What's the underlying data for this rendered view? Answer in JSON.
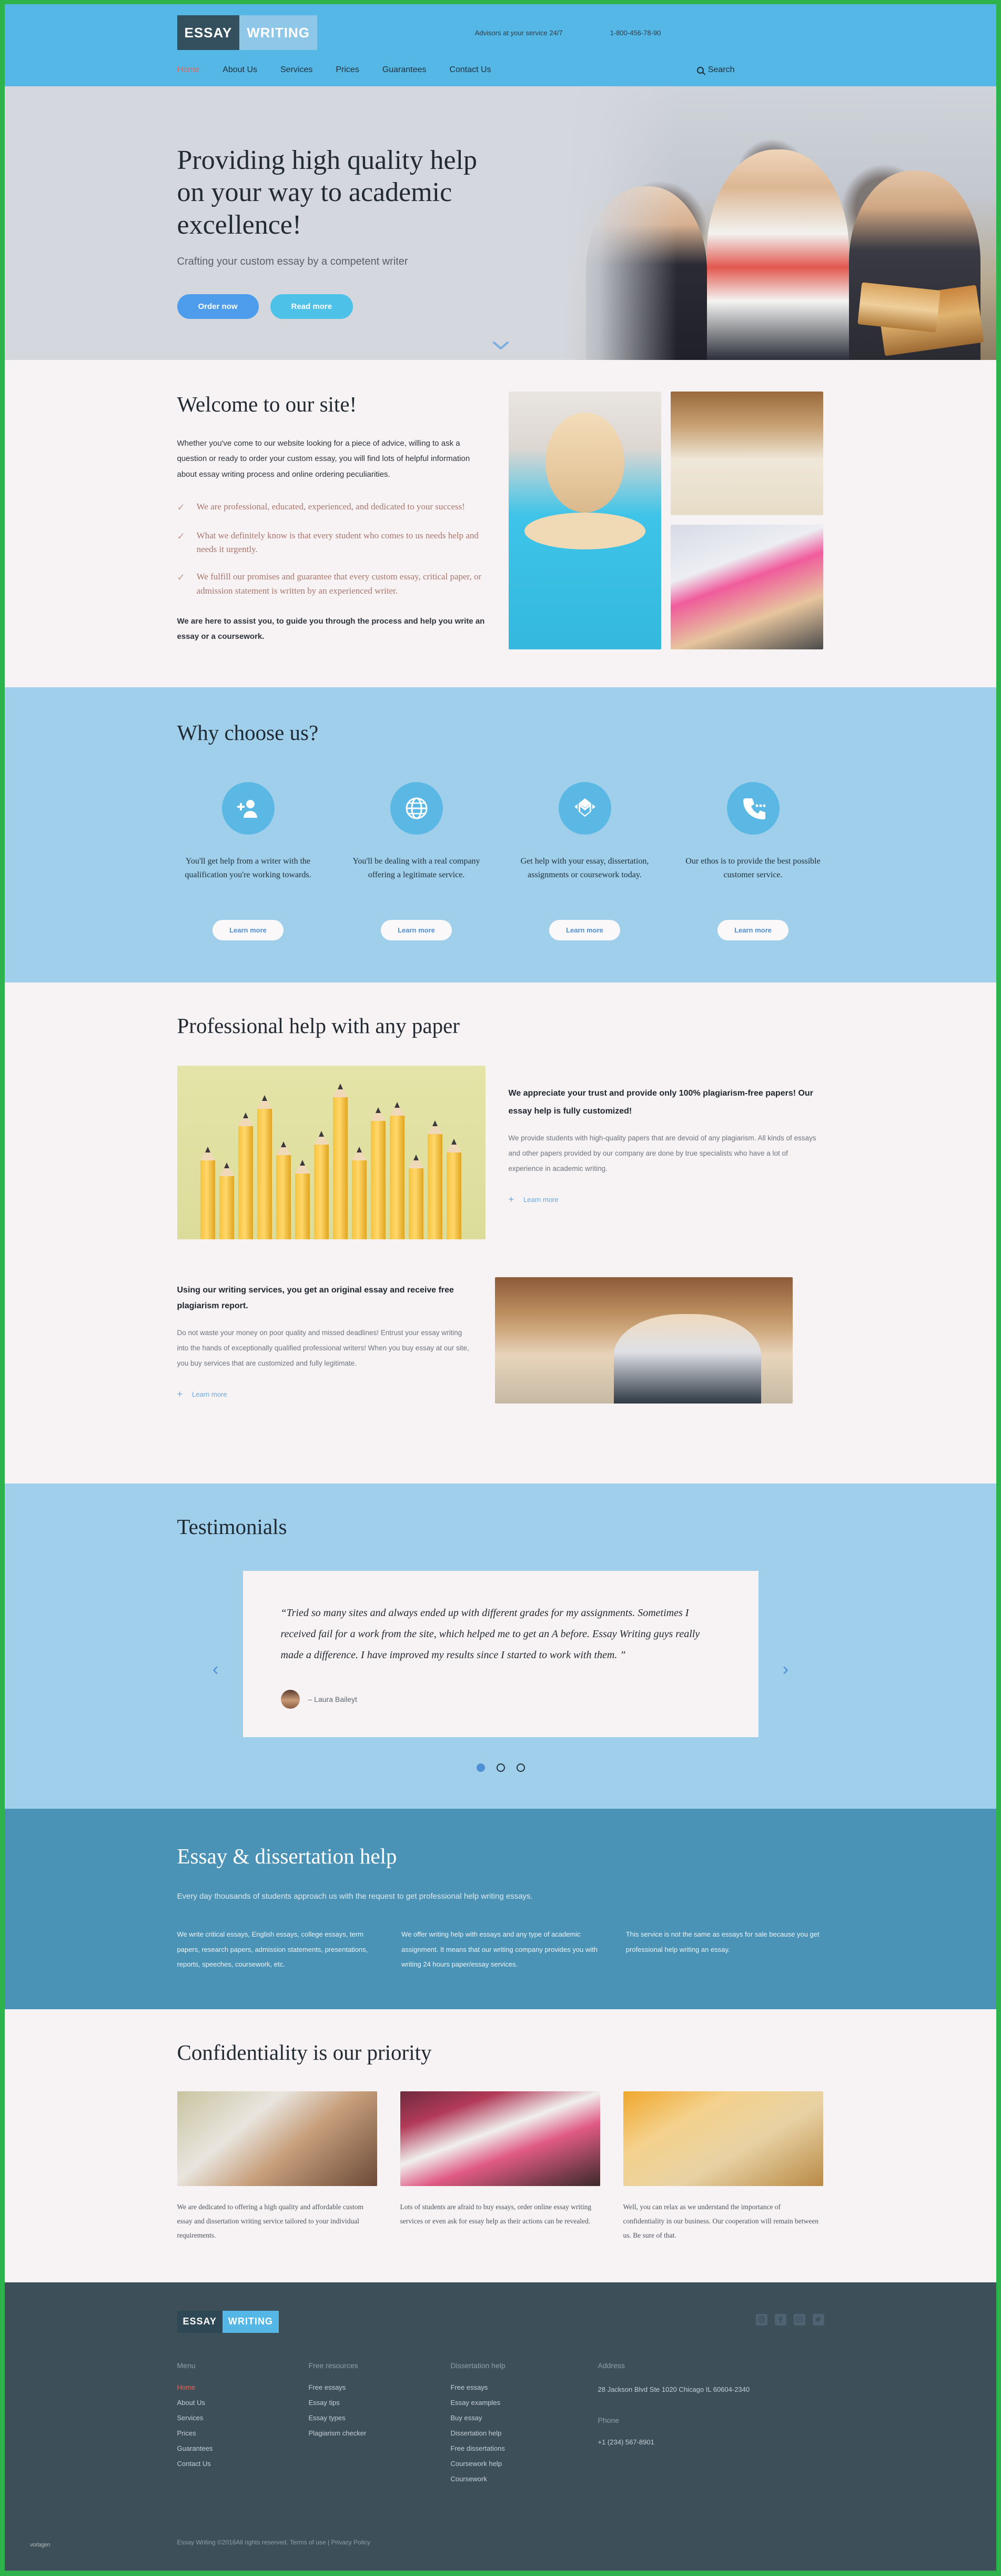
{
  "header": {
    "logo": {
      "part1": "ESSAY",
      "part2": "WRITING"
    },
    "advisors": "Advisors at your service 24/7",
    "phone": "1-800-456-78-90",
    "nav": [
      {
        "label": "Home",
        "active": true
      },
      {
        "label": "About Us",
        "active": false
      },
      {
        "label": "Services",
        "active": false
      },
      {
        "label": "Prices",
        "active": false
      },
      {
        "label": "Guarantees",
        "active": false
      },
      {
        "label": "Contact Us",
        "active": false
      }
    ],
    "search_label": "Search"
  },
  "hero": {
    "title": "Providing high quality help on your way to academic excellence!",
    "subtitle": "Crafting your custom essay by a competent writer",
    "btn_order": "Order now",
    "btn_read": "Read more"
  },
  "welcome": {
    "heading": "Welcome to our site!",
    "lead": "Whether you've come to our website looking for a piece of advice, willing to ask a question or ready to order your custom essay, you will find lots of helpful information about essay writing process and online ordering peculiarities.",
    "bullets": [
      "We are professional, educated, experienced, and dedicated to your success!",
      "What we definitely know is that every student who comes to us needs help and needs it urgently.",
      "We fulfill our promises and guarantee that every custom essay, critical paper, or admission statement is written by an experienced writer."
    ],
    "tail": "We are here to assist you, to guide you through the process and help you write an essay or a coursework."
  },
  "why": {
    "heading": "Why choose us?",
    "items": [
      {
        "icon": "add-user-icon",
        "text": "You'll get help from a writer with the qualification you're working towards.",
        "button": "Learn more"
      },
      {
        "icon": "globe-icon",
        "text": "You'll be dealing with a real company offering a legitimate service.",
        "button": "Learn more"
      },
      {
        "icon": "graduation-cap-icon",
        "text": "Get help with your essay, dissertation, assignments or coursework today.",
        "button": "Learn more"
      },
      {
        "icon": "phone-icon",
        "text": "Our ethos is to provide the best possible customer service.",
        "button": "Learn more"
      }
    ]
  },
  "professional": {
    "heading": "Professional help with any paper",
    "block1": {
      "title": "We appreciate your trust and provide only 100% plagiarism-free papers! Our essay help is fully customized!",
      "body": "We provide students with high-quality papers that are devoid of any plagiarism. All kinds of essays and other papers provided by our company are done by true specialists who have a lot of experience in academic writing.",
      "link": "Learn more"
    },
    "block2": {
      "title": "Using our writing services, you get an original essay and receive free plagiarism report.",
      "body": "Do not waste your money on poor quality and missed deadlines! Entrust your essay writing into the hands of exceptionally qualified professional writers! When you buy essay at our site, you buy services that are customized and fully legitimate.",
      "link": "Learn more"
    }
  },
  "testimonials": {
    "heading": "Testimonials",
    "quote": "“Tried so many sites and always ended up with different grades for my assignments. Sometimes I received fail for a work from the site, which helped me to get an A before. Essay Writing guys really made a difference. I have improved my results since I started to work with them. ”",
    "author": "– Laura Baileyt",
    "prev": "‹",
    "next": "›",
    "dots": 3,
    "active_dot": 0
  },
  "dissertation": {
    "heading": "Essay & dissertation help",
    "subtitle": "Every day thousands of students approach us with the request to get professional help writing essays.",
    "columns": [
      "We write critical essays, English essays, college essays, term papers, research papers, admission statements, presentations, reports, speeches, coursework, etc.",
      "We offer writing help with essays and any type of academic assignment. It means that our writing company provides you with writing 24 hours paper/essay services.",
      "This service is not the same as essays for sale because you get professional help writing an essay."
    ]
  },
  "confidentiality": {
    "heading": "Confidentiality is our priority",
    "items": [
      "We are dedicated to offering a high quality and affordable custom essay and dissertation writing service tailored to your individual requirements.",
      "Lots of students are afraid to buy essays, order online essay writing services or even ask for essay help as their actions can be revealed.",
      "Well, you can relax as we understand the importance of confidentiality in our business. Our cooperation will remain between us. Be sure of that."
    ]
  },
  "footer": {
    "logo": {
      "part1": "ESSAY",
      "part2": "WRITING"
    },
    "socials": [
      "instagram-icon",
      "facebook-icon",
      "youtube-icon",
      "twitter-icon"
    ],
    "menu": {
      "title": "Menu",
      "links": [
        {
          "label": "Home",
          "active": true
        },
        {
          "label": "About Us",
          "active": false
        },
        {
          "label": "Services",
          "active": false
        },
        {
          "label": "Prices",
          "active": false
        },
        {
          "label": "Guarantees",
          "active": false
        },
        {
          "label": "Contact Us",
          "active": false
        }
      ]
    },
    "resources": {
      "title": "Free resources",
      "links": [
        {
          "label": "Free essays"
        },
        {
          "label": "Essay tips"
        },
        {
          "label": "Essay types"
        },
        {
          "label": "Plagiarism checker"
        }
      ]
    },
    "dissertation": {
      "title": "Dissertation help",
      "links": [
        {
          "label": "Free essays"
        },
        {
          "label": "Essay examples"
        },
        {
          "label": "Buy essay"
        },
        {
          "label": "Dissertation help"
        },
        {
          "label": "Free dissertations"
        },
        {
          "label": "Coursework help"
        },
        {
          "label": "Coursework"
        }
      ]
    },
    "contact": {
      "address_title": "Address",
      "address": "28 Jackson Blvd Ste 1020 Chicago IL 60604-2340",
      "phone_title": "Phone",
      "phone": "+1 (234) 567-8901"
    },
    "copyright": "Essay Writing ©2016All rights reserved. Terms of use | Privacy Policy",
    "watermark": "vorlagen"
  }
}
